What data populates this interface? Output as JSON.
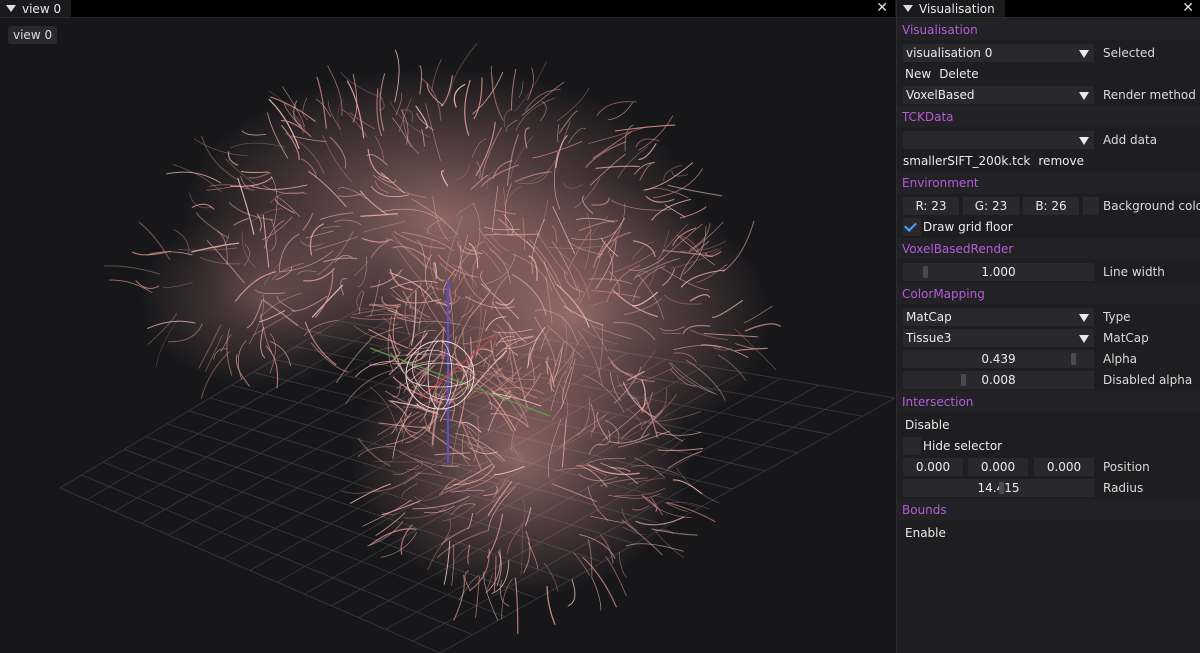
{
  "left_window": {
    "tab_title": "view 0",
    "view_button": "view 0"
  },
  "right_window": {
    "tab_title": "Visualisation"
  },
  "sections": {
    "visualisation": "Visualisation",
    "tckdata": "TCKData",
    "environment": "Environment",
    "voxelrender": "VoxelBasedRender",
    "colormapping": "ColorMapping",
    "intersection": "Intersection",
    "bounds": "Bounds"
  },
  "visualisation": {
    "selected_value": "visualisation 0",
    "selected_label": "Selected",
    "new_label": "New",
    "delete_label": "Delete",
    "render_method_value": "VoxelBased",
    "render_method_label": "Render method"
  },
  "tckdata": {
    "add_data_value": "",
    "add_data_label": "Add data",
    "file_name": "smallerSIFT_200k.tck",
    "remove_label": "remove"
  },
  "environment": {
    "r": "R: 23",
    "g": "G: 23",
    "b": "B: 26",
    "bg_label": "Background color",
    "grid_label": "Draw grid floor",
    "grid_checked": true
  },
  "voxelrender": {
    "line_width_value": "1.000",
    "line_width_label": "Line width"
  },
  "colormapping": {
    "type_value": "MatCap",
    "type_label": "Type",
    "matcap_value": "Tissue3",
    "matcap_label": "MatCap",
    "alpha_value": "0.439",
    "alpha_label": "Alpha",
    "disabled_alpha_value": "0.008",
    "disabled_alpha_label": "Disabled alpha"
  },
  "intersection": {
    "disable_label": "Disable",
    "hide_selector_label": "Hide selector",
    "pos_x": "0.000",
    "pos_y": "0.000",
    "pos_z": "0.000",
    "position_label": "Position",
    "radius_value": "14.415",
    "radius_label": "Radius"
  },
  "bounds": {
    "enable_label": "Enable"
  },
  "colors": {
    "accent": "#b35cd6",
    "background": "#17171a",
    "fibers": "#e3a09a",
    "check": "#4aa3ff"
  },
  "icons": {
    "tab_menu": "triangle-down-icon",
    "close": "close-icon",
    "dropdown": "dropdown-arrow-icon",
    "check": "checkmark-icon"
  }
}
